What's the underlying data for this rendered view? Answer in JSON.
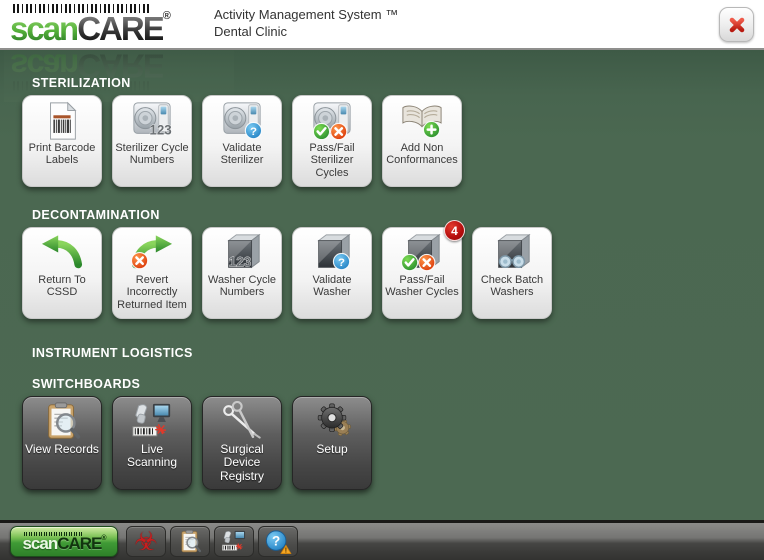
{
  "brand": {
    "part1": "scan",
    "part2": "CARE",
    "registered": "®"
  },
  "header": {
    "title": "Activity Management System ™",
    "subtitle": "Dental Clinic"
  },
  "colors": {
    "background_green": "#4b6851",
    "logo_green": "#4ea53c",
    "badge_red": "#b50d0d",
    "badge_green": "#2a8f2f",
    "badge_orange": "#e03c0a",
    "badge_blue": "#1f86c8",
    "close_red": "#c41f14"
  },
  "sections": [
    {
      "id": "sterilization",
      "label": "STERILIZATION",
      "style": "light",
      "buttons": [
        {
          "label": "Print Barcode Labels",
          "icon": "barcode-labels-icon"
        },
        {
          "label": "Sterilizer Cycle Numbers",
          "icon": "sterilizer-123-icon"
        },
        {
          "label": "Validate Sterilizer",
          "icon": "sterilizer-question-icon"
        },
        {
          "label": "Pass/Fail Sterilizer Cycles",
          "icon": "sterilizer-passfail-icon"
        },
        {
          "label": "Add Non Conformances",
          "icon": "book-add-icon"
        }
      ]
    },
    {
      "id": "decontamination",
      "label": "DECONTAMINATION",
      "style": "light",
      "buttons": [
        {
          "label": "Return To CSSD",
          "icon": "curved-arrow-left-icon"
        },
        {
          "label": "Revert Incorrectly Returned Item",
          "icon": "curved-arrow-right-x-icon"
        },
        {
          "label": "Washer Cycle Numbers",
          "icon": "washer-123-icon"
        },
        {
          "label": "Validate Washer",
          "icon": "washer-question-icon"
        },
        {
          "label": "Pass/Fail Washer Cycles",
          "icon": "washer-passfail-icon",
          "badge": "4"
        },
        {
          "label": "Check Batch Washers",
          "icon": "washer-binoculars-icon"
        }
      ]
    },
    {
      "id": "instrument-logistics",
      "label": "INSTRUMENT LOGISTICS",
      "style": "light",
      "buttons": []
    },
    {
      "id": "switchboards",
      "label": "SWITCHBOARDS",
      "style": "dark",
      "buttons": [
        {
          "label": "View Records",
          "icon": "records-magnifier-icon"
        },
        {
          "label": "Live Scanning",
          "icon": "live-scanning-icon"
        },
        {
          "label": "Surgical Device Registry",
          "icon": "surgical-instrument-icon"
        },
        {
          "label": "Setup",
          "icon": "gears-icon"
        }
      ]
    }
  ],
  "taskbar": {
    "buttons": [
      {
        "name": "taskbar-biohazard-button",
        "icon": "biohazard-icon"
      },
      {
        "name": "taskbar-records-button",
        "icon": "records-magnifier-icon"
      },
      {
        "name": "taskbar-scanning-button",
        "icon": "live-scanning-icon"
      },
      {
        "name": "taskbar-help-button",
        "icon": "help-warning-icon"
      }
    ]
  }
}
